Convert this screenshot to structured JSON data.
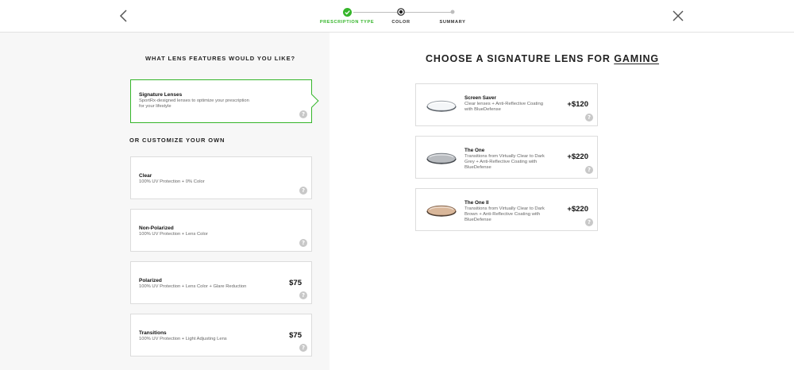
{
  "header": {
    "steps": [
      {
        "label": "PRESCRIPTION TYPE",
        "state": "complete"
      },
      {
        "label": "COLOR",
        "state": "current"
      },
      {
        "label": "SUMMARY",
        "state": "upcoming"
      }
    ]
  },
  "left": {
    "question": "WHAT LENS FEATURES WOULD YOU LIKE?",
    "signature": {
      "name": "Signature Lenses",
      "desc": "SportRx-designed lenses to optimize your prescription for your lifestyle"
    },
    "customize_title": "OR CUSTOMIZE YOUR OWN",
    "options": [
      {
        "name": "Clear",
        "desc": "100% UV Protection + 0% Color",
        "price": ""
      },
      {
        "name": "Non-Polarized",
        "desc": "100% UV Protection + Lens Color",
        "price": ""
      },
      {
        "name": "Polarized",
        "desc": "100% UV Protection + Lens Color + Glare Reduction",
        "price": "$75"
      },
      {
        "name": "Transitions",
        "desc": "100% UV Protection + Light Adjusting Lens",
        "price": "$75"
      }
    ]
  },
  "right": {
    "title_prefix": "CHOOSE A SIGNATURE LENS FOR ",
    "title_keyword": "GAMING",
    "lenses": [
      {
        "name": "Screen Saver",
        "desc": "Clear lenses + Anti-Reflective Coating with BlueDefense",
        "price": "+$120",
        "tint": "#f4f6f8"
      },
      {
        "name": "The One",
        "desc": "Transitions from Virtually Clear to Dark Grey + Anti-Reflective Coating with BlueDefense",
        "price": "+$220",
        "tint": "#b9bcc0"
      },
      {
        "name": "The One II",
        "desc": "Transitions from Virtually Clear to Dark Brown + Anti-Reflective Coating with BlueDefense",
        "price": "+$220",
        "tint": "#d9b79a"
      }
    ]
  },
  "help_glyph": "?",
  "colors": {
    "accent": "#35b52a",
    "border": "#dcdcdc",
    "panel": "#f7f7f7"
  }
}
